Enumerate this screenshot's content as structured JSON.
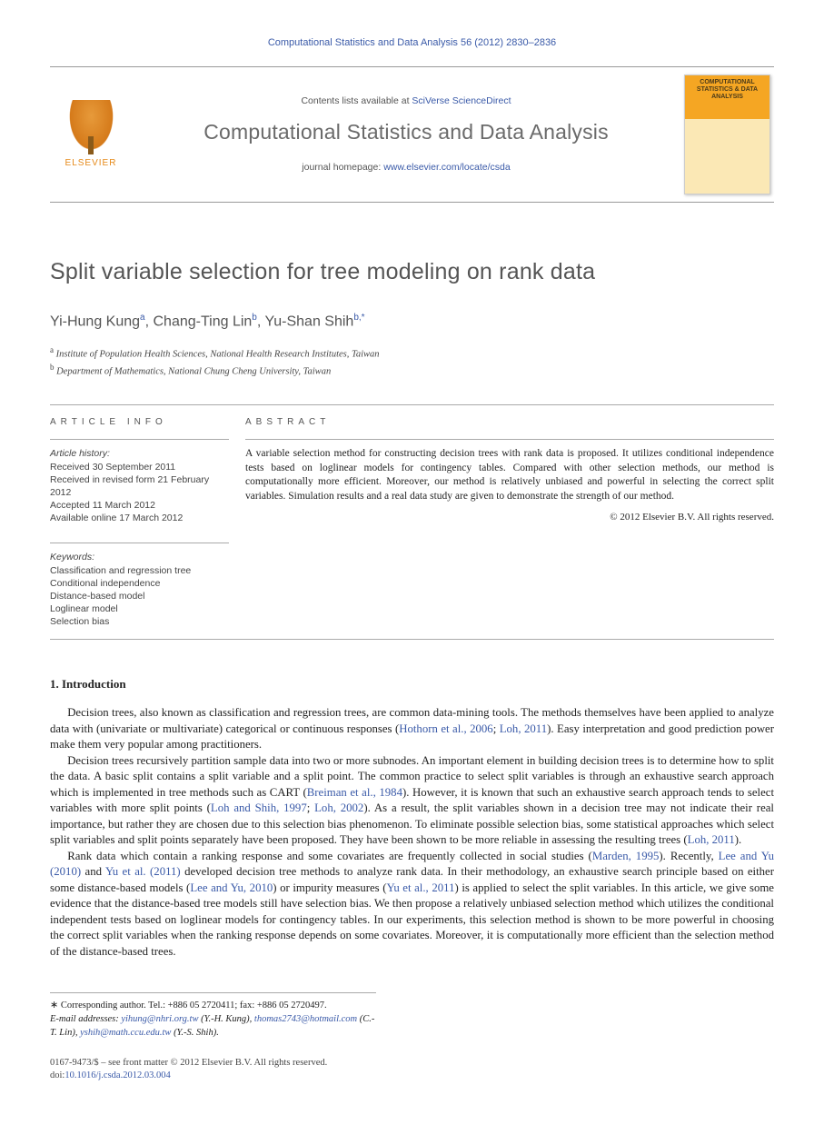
{
  "header_citation": "Computational Statistics and Data Analysis 56 (2012) 2830–2836",
  "masthead": {
    "publisher": "ELSEVIER",
    "contents_prefix": "Contents lists available at ",
    "contents_link": "SciVerse ScienceDirect",
    "journal_title": "Computational Statistics and Data Analysis",
    "homepage_prefix": "journal homepage: ",
    "homepage_url": "www.elsevier.com/locate/csda",
    "cover_text": "COMPUTATIONAL STATISTICS & DATA ANALYSIS"
  },
  "title": "Split variable selection for tree modeling on rank data",
  "authors": [
    {
      "name": "Yi-Hung Kung",
      "aff": "a"
    },
    {
      "name": "Chang-Ting Lin",
      "aff": "b"
    },
    {
      "name": "Yu-Shan Shih",
      "aff": "b,*"
    }
  ],
  "author_joined": "Yi-Hung Kung",
  "affiliations": {
    "a": "Institute of Population Health Sciences, National Health Research Institutes, Taiwan",
    "b": "Department of Mathematics, National Chung Cheng University, Taiwan"
  },
  "info": {
    "heading": "ARTICLE INFO",
    "history_label": "Article history:",
    "history": [
      "Received 30 September 2011",
      "Received in revised form 21 February 2012",
      "Accepted 11 March 2012",
      "Available online 17 March 2012"
    ],
    "keywords_label": "Keywords:",
    "keywords": [
      "Classification and regression tree",
      "Conditional independence",
      "Distance-based model",
      "Loglinear model",
      "Selection bias"
    ]
  },
  "abstract": {
    "heading": "ABSTRACT",
    "text": "A variable selection method for constructing decision trees with rank data is proposed. It utilizes conditional independence tests based on loglinear models for contingency tables. Compared with other selection methods, our method is computationally more efficient. Moreover, our method is relatively unbiased and powerful in selecting the correct split variables. Simulation results and a real data study are given to demonstrate the strength of our method.",
    "copyright": "© 2012 Elsevier B.V. All rights reserved."
  },
  "section1": {
    "heading": "1. Introduction",
    "p1_a": "Decision trees, also known as classification and regression trees, are common data-mining tools. The methods themselves have been applied to analyze data with (univariate or multivariate) categorical or continuous responses (",
    "p1_cite1": "Hothorn et al., 2006",
    "p1_sep1": "; ",
    "p1_cite2": "Loh, 2011",
    "p1_b": "). Easy interpretation and good prediction power make them very popular among practitioners.",
    "p2_a": "Decision trees recursively partition sample data into two or more subnodes. An important element in building decision trees is to determine how to split the data. A basic split contains a split variable and a split point. The common practice to select split variables is through an exhaustive search approach which is implemented in tree methods such as CART (",
    "p2_cite1": "Breiman et al., 1984",
    "p2_b": "). However, it is known that such an exhaustive search approach tends to select variables with more split points (",
    "p2_cite2": "Loh and Shih, 1997",
    "p2_sep1": "; ",
    "p2_cite3": "Loh, 2002",
    "p2_c": "). As a result, the split variables shown in a decision tree may not indicate their real importance, but rather they are chosen due to this selection bias phenomenon. To eliminate possible selection bias, some statistical approaches which select split variables and split points separately have been proposed. They have been shown to be more reliable in assessing the resulting trees (",
    "p2_cite4": "Loh, 2011",
    "p2_d": ").",
    "p3_a": "Rank data which contain a ranking response and some covariates are frequently collected in social studies (",
    "p3_cite1": "Marden, 1995",
    "p3_b": "). Recently, ",
    "p3_cite2": "Lee and Yu (2010)",
    "p3_c": " and ",
    "p3_cite3": "Yu et al. (2011)",
    "p3_d": " developed decision tree methods to analyze rank data. In their methodology, an exhaustive search principle based on either some distance-based models (",
    "p3_cite4": "Lee and Yu, 2010",
    "p3_e": ") or impurity measures (",
    "p3_cite5": "Yu et al., 2011",
    "p3_f": ") is applied to select the split variables. In this article, we give some evidence that the distance-based tree models still have selection bias. We then propose a relatively unbiased selection method which utilizes the conditional independent tests based on loglinear models for contingency tables. In our experiments, this selection method is shown to be more powerful in choosing the correct split variables when the ranking response depends on some covariates. Moreover, it is computationally more efficient than the selection method of the distance-based trees."
  },
  "footnotes": {
    "corr": "Corresponding author. Tel.: +886 05 2720411; fax: +886 05 2720497.",
    "emails_label": "E-mail addresses:",
    "emails": [
      {
        "addr": "yihung@nhri.org.tw",
        "who": "(Y.-H. Kung)"
      },
      {
        "addr": "thomas2743@hotmail.com",
        "who": "(C.-T. Lin)"
      },
      {
        "addr": "yshih@math.ccu.edu.tw",
        "who": "(Y.-S. Shih)"
      }
    ]
  },
  "footer": {
    "issn_line": "0167-9473/$ – see front matter © 2012 Elsevier B.V. All rights reserved.",
    "doi_label": "doi:",
    "doi": "10.1016/j.csda.2012.03.004"
  }
}
